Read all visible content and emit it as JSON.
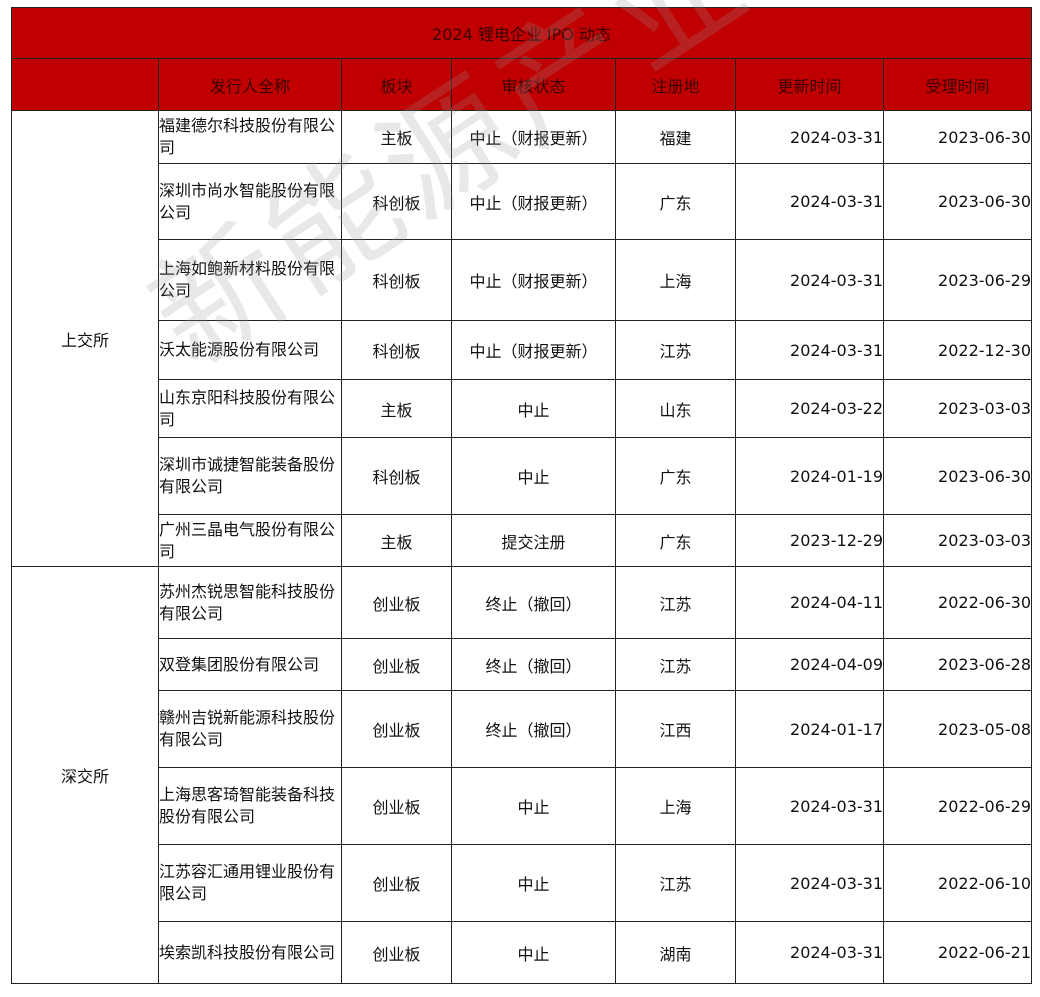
{
  "title": "2024 锂电企业 IPO 动态",
  "headers": [
    "发行人全称",
    "板块",
    "审核状态",
    "注册地",
    "更新时间",
    "受理时间"
  ],
  "exchanges": [
    {
      "name": "上交所",
      "rows": [
        {
          "name": "福建德尔科技股份有限公司",
          "board": "主板",
          "status": "中止（财报更新）",
          "region": "福建",
          "updated": "2024-03-31",
          "accepted": "2023-06-30"
        },
        {
          "name": "深圳市尚水智能股份有限公司",
          "board": "科创板",
          "status": "中止（财报更新）",
          "region": "广东",
          "updated": "2024-03-31",
          "accepted": "2023-06-30"
        },
        {
          "name": "上海如鲍新材料股份有限公司",
          "board": "科创板",
          "status": "中止（财报更新）",
          "region": "上海",
          "updated": "2024-03-31",
          "accepted": "2023-06-29"
        },
        {
          "name": "沃太能源股份有限公司",
          "board": "科创板",
          "status": "中止（财报更新）",
          "region": "江苏",
          "updated": "2024-03-31",
          "accepted": "2022-12-30"
        },
        {
          "name": "山东京阳科技股份有限公司",
          "board": "主板",
          "status": "中止",
          "region": "山东",
          "updated": "2024-03-22",
          "accepted": "2023-03-03"
        },
        {
          "name": "深圳市诚捷智能装备股份有限公司",
          "board": "科创板",
          "status": "中止",
          "region": "广东",
          "updated": "2024-01-19",
          "accepted": "2023-06-30"
        },
        {
          "name": "广州三晶电气股份有限公司",
          "board": "主板",
          "status": "提交注册",
          "region": "广东",
          "updated": "2023-12-29",
          "accepted": "2023-03-03"
        }
      ]
    },
    {
      "name": "深交所",
      "rows": [
        {
          "name": "苏州杰锐思智能科技股份有限公司",
          "board": "创业板",
          "status": "终止（撤回）",
          "region": "江苏",
          "updated": "2024-04-11",
          "accepted": "2022-06-30"
        },
        {
          "name": "双登集团股份有限公司",
          "board": "创业板",
          "status": "终止（撤回）",
          "region": "江苏",
          "updated": "2024-04-09",
          "accepted": "2023-06-28"
        },
        {
          "name": "赣州吉锐新能源科技股份有限公司",
          "board": "创业板",
          "status": "终止（撤回）",
          "region": "江西",
          "updated": "2024-01-17",
          "accepted": "2023-05-08"
        },
        {
          "name": "上海思客琦智能装备科技股份有限公司",
          "board": "创业板",
          "status": "中止",
          "region": "上海",
          "updated": "2024-03-31",
          "accepted": "2022-06-29"
        },
        {
          "name": "江苏容汇通用锂业股份有限公司",
          "board": "创业板",
          "status": "中止",
          "region": "江苏",
          "updated": "2024-03-31",
          "accepted": "2022-06-10"
        },
        {
          "name": "埃索凯科技股份有限公司",
          "board": "创业板",
          "status": "中止",
          "region": "湖南",
          "updated": "2024-03-31",
          "accepted": "2022-06-21"
        }
      ]
    }
  ],
  "watermark": "新能源产业家"
}
